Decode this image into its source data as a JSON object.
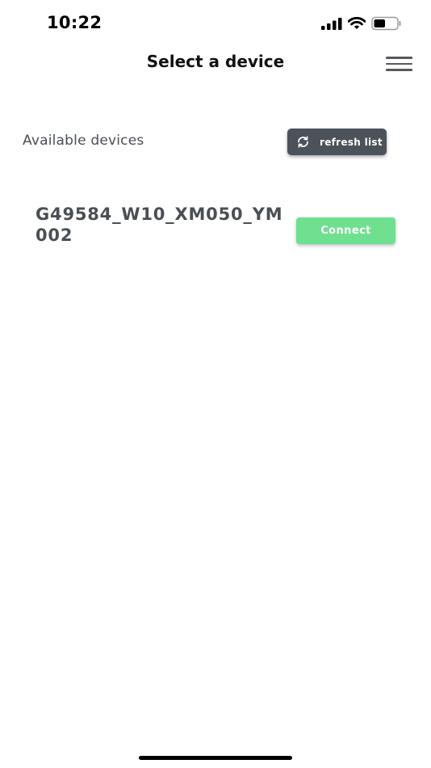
{
  "status_bar": {
    "time": "10:22",
    "icons": [
      "cellular-signal-icon",
      "wifi-icon",
      "battery-icon"
    ],
    "battery_level": 0.5
  },
  "header": {
    "title": "Select a device",
    "menu_icon": "hamburger-menu-icon"
  },
  "devices_section": {
    "label": "Available devices",
    "refresh_button": {
      "label": "refresh list",
      "icon": "refresh-icon"
    },
    "devices": [
      {
        "name": "G49584_W10_XM050_YM002",
        "connect_label": "Connect"
      }
    ]
  },
  "colors": {
    "refresh_button_bg": "#4c525a",
    "connect_button_bg": "#6fe08f",
    "text_muted": "#4a4f55"
  }
}
